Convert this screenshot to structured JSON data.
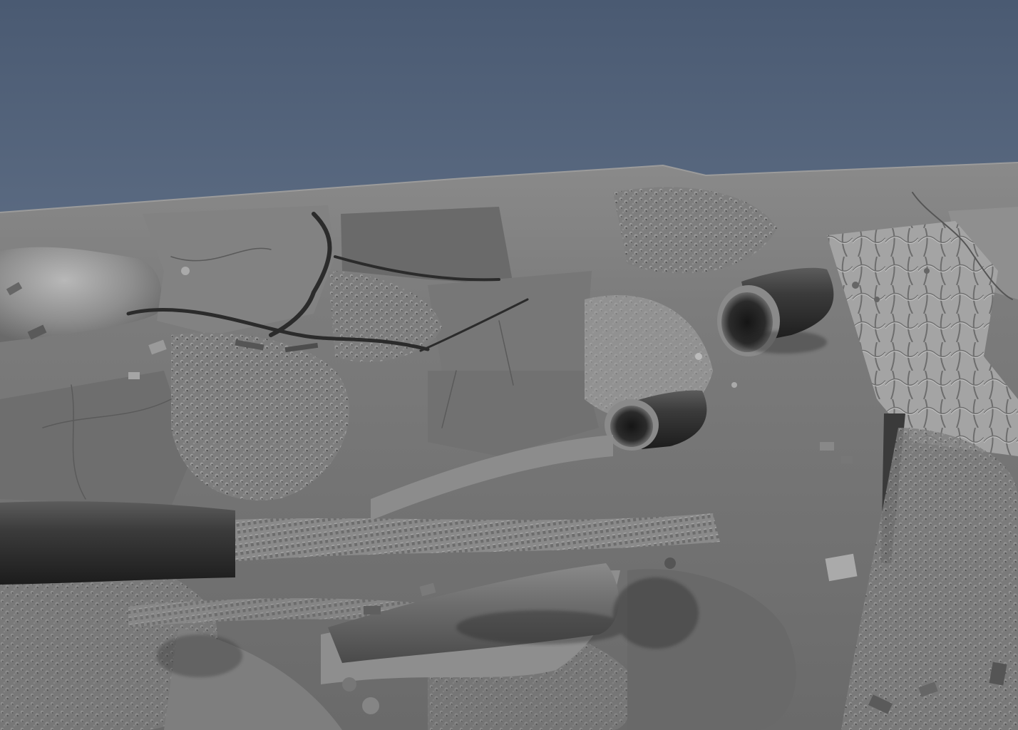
{
  "viewport": {
    "type": "3d-viewport",
    "background_gradient": [
      "#4a5a72",
      "#7f8ea3"
    ],
    "scene": {
      "subject": "sculpted-rubble-terrain",
      "colors": {
        "ground_plane": "#8c8c8c",
        "terrain_base": "#787878",
        "terrain_light": "#a8a8a8",
        "terrain_dark": "#444444",
        "crack": "#2a2a2a",
        "pipe": "#3a3a3a"
      }
    }
  }
}
